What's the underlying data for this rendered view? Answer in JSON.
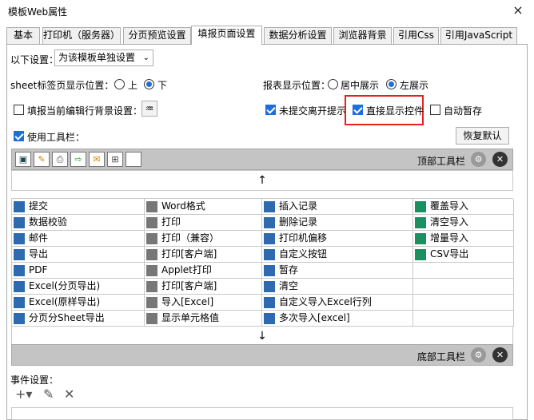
{
  "window": {
    "title": "模板Web属性",
    "close_icon": "×"
  },
  "tabs": [
    "基本",
    "打印机（服务器）",
    "分页预览设置",
    "填报页面设置",
    "数据分析设置",
    "浏览器背景",
    "引用Css",
    "引用JavaScript"
  ],
  "settings": {
    "label": "以下设置：",
    "select_value": "为该模板单独设置",
    "sheet_pos_label": "sheet标签页显示位置：",
    "sheet_opt_up": "上",
    "sheet_opt_down": "下",
    "report_pos_label": "报表显示位置：",
    "report_opt_center": "居中展示",
    "report_opt_left": "左展示",
    "fill_bg_label": "填报当前编辑行背景设置：",
    "unsubmitted_leave": "未提交离开提示",
    "direct_show": "直接显示控件",
    "auto_save": "自动暂存",
    "use_toolbar": "使用工具栏：",
    "restore_default": "恢复默认",
    "top_toolbar": "顶部工具栏",
    "bottom_toolbar": "底部工具栏",
    "up_arrow": "↑",
    "down_arrow": "↓",
    "event_label": "事件设置："
  },
  "buttons": [
    [
      "提交",
      "Word格式",
      "插入记录",
      "覆盖导入"
    ],
    [
      "数据校验",
      "打印",
      "删除记录",
      "清空导入"
    ],
    [
      "邮件",
      "打印（兼容）",
      "打印机偏移",
      "增量导入"
    ],
    [
      "导出",
      "打印[客户端]",
      "自定义按钮",
      "CSV导出"
    ],
    [
      "PDF",
      "Applet打印",
      "暂存",
      ""
    ],
    [
      "Excel(分页导出)",
      "打印[客户端]",
      "清空",
      ""
    ],
    [
      "Excel(原样导出)",
      "导入[Excel]",
      "自定义导入Excel行列",
      ""
    ],
    [
      "分页分Sheet导出",
      "显示单元格值",
      "多次导入[excel]",
      ""
    ]
  ],
  "colors": {
    "accent": "#1e6fd9",
    "highlight": "#e8201c",
    "toolbar": "#c4c4c4"
  }
}
